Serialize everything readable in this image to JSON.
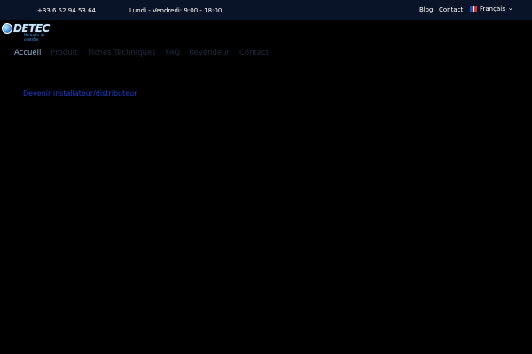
{
  "topbar": {
    "phone": "+33 6 52 94 53 64",
    "hours": "Lundi - Vendredi: 9:00 - 18:00",
    "blog_label": "Blog",
    "contact_label": "Contact",
    "language_label": "Français",
    "language_flag_icon": "flag-fr-icon",
    "dropdown_icon": "chevron-down-icon"
  },
  "logo": {
    "wordmark": "DETEC",
    "tagline": "Ma boîte de contrôle"
  },
  "nav": {
    "items": [
      {
        "label": "Accueil",
        "active": true
      },
      {
        "label": "Produit",
        "active": false
      },
      {
        "label": "Fiches Techniques",
        "active": false
      },
      {
        "label": "FAQ",
        "active": false
      },
      {
        "label": "Revendeur",
        "active": false
      },
      {
        "label": "Contact",
        "active": false
      }
    ]
  },
  "cta": {
    "label": "Devenir installateur/distributeur"
  },
  "colors": {
    "topbar_bg": "#0a1428",
    "page_bg": "#000000",
    "nav_active": "#8fb6de",
    "nav_dim": "#1e2c40",
    "cta": "#1f3fd4"
  }
}
